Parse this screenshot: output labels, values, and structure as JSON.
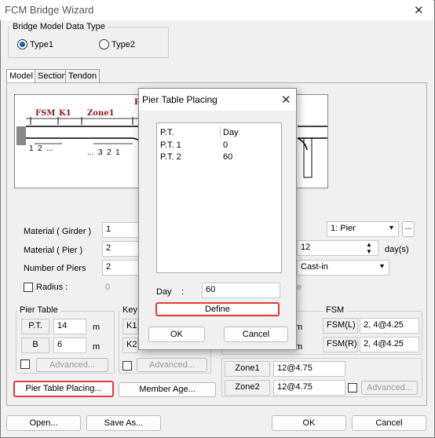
{
  "window": {
    "title": "FCM Bridge Wizard",
    "close": "✕"
  },
  "model_type": {
    "legend": "Bridge Model Data Type",
    "type1": "Type1",
    "type2": "Type2",
    "selected": "Type1"
  },
  "tabs": [
    "Model",
    "Section",
    "Tendon"
  ],
  "drawing": {
    "fsm": "FSM",
    "k1": "K1",
    "zone1": "Zone1",
    "p": "P",
    "left_nums": "1  2  ...",
    "right_nums": "...  3  2  1"
  },
  "fields": {
    "material_girder": {
      "label": "Material ( Girder )",
      "value": "1"
    },
    "material_pier": {
      "label": "Material ( Pier )",
      "value": "2"
    },
    "num_piers": {
      "label": "Number of Piers",
      "value": "2"
    },
    "radius": {
      "label": "Radius :",
      "value": "0"
    },
    "pier_select": "1: Pier",
    "days_value": "12",
    "days_unit": "day(s)",
    "cast_in": "Cast-in",
    "cast_in_suffix": "e"
  },
  "pier_table": {
    "legend": "Pier Table",
    "pt_label": "P.T.",
    "pt_value": "14",
    "pt_unit": "m",
    "b_label": "B",
    "b_value": "6",
    "b_unit": "m",
    "advanced": "Advanced...",
    "placing_btn": "Pier Table Placing..."
  },
  "key_seg": {
    "legend": "Key S",
    "k1": "K1",
    "k2": "K2",
    "unit": "m",
    "advanced": "Advanced...",
    "member_age_btn": "Member Age..."
  },
  "fsm": {
    "legend": "FSM",
    "fsml": "FSM(L)",
    "fsml_value": "2, 4@4.25",
    "fsmr": "FSM(R)",
    "fsmr_value": "2, 4@4.25"
  },
  "zones": {
    "zone1": "Zone1",
    "zone1_value": "12@4.75",
    "zone2": "Zone2",
    "zone2_value": "12@4.75",
    "advanced": "Advanced..."
  },
  "bottom": {
    "open": "Open...",
    "save_as": "Save As...",
    "ok": "OK",
    "cancel": "Cancel"
  },
  "dialog": {
    "title": "Pier Table Placing",
    "close": "✕",
    "col_pt": "P.T.",
    "col_day": "Day",
    "rows": [
      {
        "pt": "P.T. 1",
        "day": "0"
      },
      {
        "pt": "P.T. 2",
        "day": "60"
      }
    ],
    "day_label": "Day",
    "day_colon": ":",
    "day_value": "60",
    "define": "Define",
    "ok": "OK",
    "cancel": "Cancel"
  }
}
